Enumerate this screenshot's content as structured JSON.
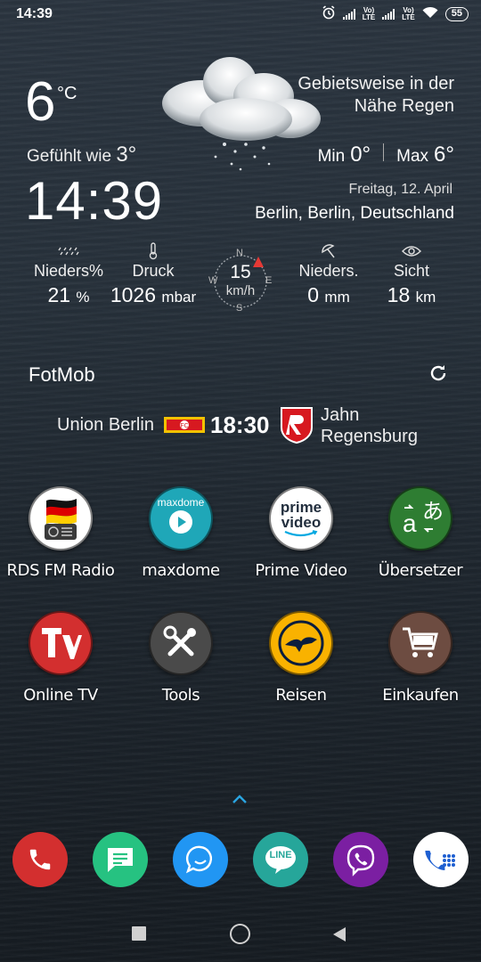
{
  "status_bar": {
    "time": "14:39",
    "battery": "55",
    "sim1": "Vo) LTE",
    "sim2": "Vo) LTE"
  },
  "weather": {
    "temperature": "6",
    "unit": "°C",
    "feels_label": "Gefühlt wie",
    "feels_value": "3°",
    "clock": "14:39",
    "condition": "Gebietsweise in der Nähe Regen",
    "min_label": "Min",
    "min_value": "0°",
    "max_label": "Max",
    "max_value": "6°",
    "date": "Freitag, 12. April",
    "location": "Berlin, Berlin, Deutschland",
    "stats": {
      "precip_prob": {
        "label": "Nieders%",
        "value": "21",
        "unit": "%"
      },
      "pressure": {
        "label": "Druck",
        "value": "1026",
        "unit": "mbar"
      },
      "wind": {
        "value": "15",
        "unit": "km/h",
        "n": "N",
        "e": "E",
        "s": "S",
        "w": "W"
      },
      "precip": {
        "label": "Nieders.",
        "value": "0",
        "unit": "mm"
      },
      "visibility": {
        "label": "Sicht",
        "value": "18",
        "unit": "km"
      }
    }
  },
  "fotmob": {
    "title": "FotMob",
    "home_team": "Union Berlin",
    "kickoff": "18:30",
    "away_team_line1": "Jahn",
    "away_team_line2": "Regensburg"
  },
  "apps": {
    "row1": [
      "RDS FM Radio",
      "maxdome",
      "Prime Video",
      "Übersetzer"
    ],
    "row2": [
      "Online TV",
      "Tools",
      "Reisen",
      "Einkaufen"
    ],
    "maxdome_logo": "maxdome",
    "prime_logo_1": "prime",
    "prime_logo_2": "video",
    "line_logo": "LINE",
    "translate_glyph_a": "a",
    "translate_glyph_jp": "あ"
  },
  "colors": {
    "accent": "#2aa4e0",
    "radio_bg": "#ffffff",
    "maxdome_bg": "#1fa7b8",
    "tv_bg": "#d32f2f",
    "tools_bg": "#4a4a4a",
    "reisen_bg": "#f9b200",
    "shop_bg": "#6d4c41",
    "translate_bg": "#2e7d32"
  }
}
